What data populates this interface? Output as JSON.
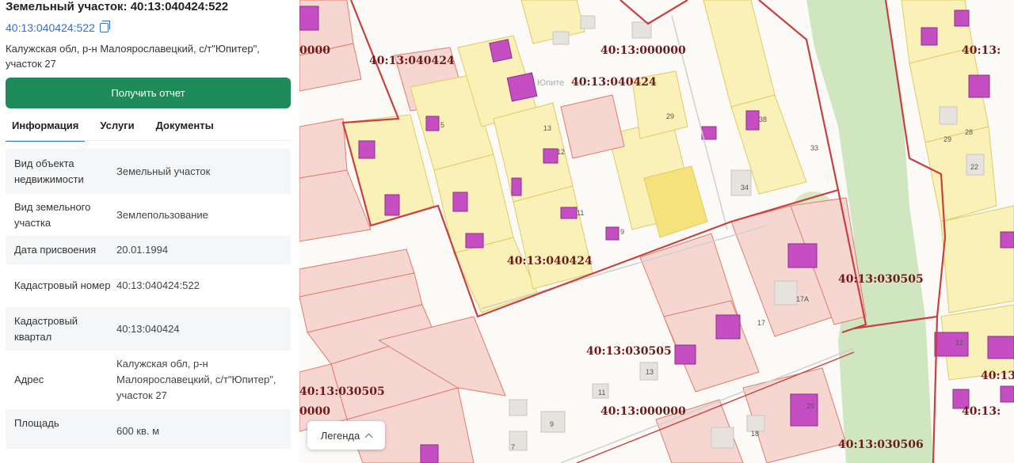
{
  "panel": {
    "title": "Земельный участок: 40:13:040424:522",
    "cadastral_link": "40:13:040424:522",
    "address": "Калужская обл, р-н Малоярославецкий, с/т\"Юпитер\", участок 27",
    "report_button": "Получить отчет",
    "tabs": [
      "Информация",
      "Услуги",
      "Документы"
    ],
    "info_rows": [
      {
        "k": "Вид объекта недвижимости",
        "v": "Земельный участок"
      },
      {
        "k": "Вид земельного участка",
        "v": "Землепользование"
      },
      {
        "k": "Дата присвоения",
        "v": "20.01.1994"
      },
      {
        "k": "Кадастровый номер",
        "v": "40:13:040424:522"
      },
      {
        "k": "Кадастровый квартал",
        "v": "40:13:040424"
      },
      {
        "k": "Адрес",
        "v": "Калужская обл, р-н Малоярославецкий, с/т\"Юпитер\", участок 27"
      },
      {
        "k": "Площадь",
        "v": "600 кв. м"
      }
    ]
  },
  "map": {
    "legend_button": "Легенда",
    "cadastral_labels": [
      "0000",
      "40:13:040424",
      "40:13:000000",
      "40:13:040424",
      "40:13:040424",
      "40:13:030505",
      "40:13:030505",
      "40:13:030505",
      "40:13:000000",
      "0000",
      "40:13:030506",
      "40:13:",
      "40:13:",
      "40:13:"
    ],
    "place_label": "Юпите",
    "plot_numbers": [
      "29",
      "38",
      "33",
      "34",
      "13",
      "12",
      "11",
      "9",
      "17А",
      "17",
      "13",
      "11",
      "9",
      "7",
      "18",
      "20",
      "29",
      "28",
      "22",
      "12",
      "5"
    ]
  }
}
